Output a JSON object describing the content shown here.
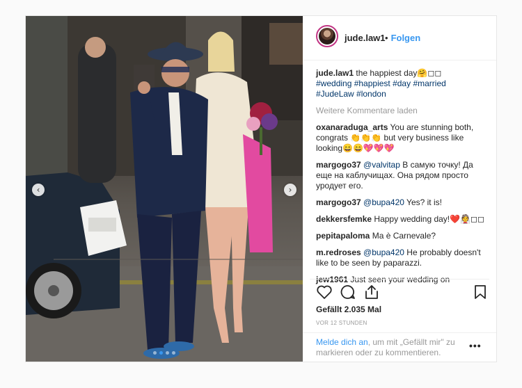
{
  "post": {
    "username": "jude.law1",
    "separator": "•",
    "follow_label": "Folgen"
  },
  "caption": {
    "user": "jude.law1",
    "text": " the happiest day🤗◻◻",
    "hashtags_line1": "#wedding #happiest #day #married",
    "hashtags_line2": "#JudeLaw #london"
  },
  "load_more": "Weitere Kommentare laden",
  "comments": [
    {
      "user": "oxanaraduga_arts",
      "mention": "",
      "text": " You are stunning both, congrats 👏👏👏 but very business like looking😄😄💖💖💖"
    },
    {
      "user": "margogo37",
      "mention": "@valvitap",
      "text": " В самую точку! Да еще на каблучищах. Она рядом просто уродует его."
    },
    {
      "user": "margogo37",
      "mention": "@bupa420",
      "text": " Yes? it is!"
    },
    {
      "user": "dekkersfemke",
      "mention": "",
      "text": " Happy wedding day!❤️👰◻◻"
    },
    {
      "user": "pepitapaloma",
      "mention": "",
      "text": " Ma è Carnevale?"
    },
    {
      "user": "m.redroses",
      "mention": "@bupa420",
      "text": " He probably doesn't like to be seen by paparazzi."
    },
    {
      "user": "jew1961",
      "mention": "",
      "text": " Just seen your wedding on"
    }
  ],
  "likes": "Gefällt 2.035 Mal",
  "timestamp": "VOR 12 STUNDEN",
  "login_prompt": {
    "link": "Melde dich an",
    "text": ", um mit „Gefällt mir\" zu markieren oder zu kommentieren."
  },
  "more_options": "•••",
  "carousel": {
    "prev": "‹",
    "next": "›",
    "active_index": 1,
    "count": 4
  }
}
